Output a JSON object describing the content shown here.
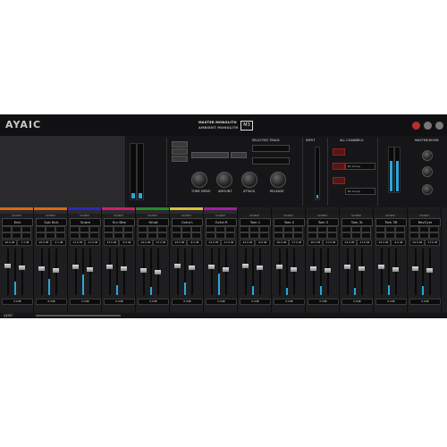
{
  "app": {
    "logo": "AYAIC",
    "brand_line1": "MASTER MONOLITH",
    "brand_line2": "AMBIENT MONOLITH",
    "badge": "M3",
    "header_buttons": [
      {
        "icon": "power-icon",
        "color": "#b23030"
      },
      {
        "icon": "settings-icon",
        "color": "#777777"
      },
      {
        "icon": "help-icon",
        "color": "#777777"
      }
    ]
  },
  "fx": {
    "selected_track_title": "SELECTED TRACK",
    "input_title": "INPUT",
    "all_channels_title": "ALL CHANNELS",
    "master_title": "MASTER/ROOM",
    "knob_labels": [
      "TONE DRIVE",
      "AMOUNT",
      "ATTACK",
      "RELEASE"
    ],
    "dropdown_value": "No Group",
    "dropdown_value_2": "No Group"
  },
  "channels": [
    {
      "name": "Kick",
      "source": "SOURCE",
      "color": "#d96a16",
      "level1": "-20.0 dB",
      "level2": "-7.4 dB",
      "gain": "0.0dB",
      "pan": 0.62,
      "meter": 0.28
    },
    {
      "name": "Sub Kick",
      "source": "SOURCE",
      "color": "#d96a16",
      "level1": "-20.0 dB",
      "level2": "-5.1 dB",
      "gain": "0.0dB",
      "pan": 0.55,
      "meter": 0.34
    },
    {
      "name": "Snare",
      "source": "SOURCE",
      "color": "#2a2ab8",
      "level1": "-17.0 dB",
      "level2": "-17.9 dB",
      "gain": "0.0dB",
      "pan": 0.58,
      "meter": 0.44
    },
    {
      "name": "Snr Btm",
      "source": "SOURCE",
      "color": "#c8236a",
      "level1": "-15.0 dB",
      "level2": "-5.8 dB",
      "gain": "0.0dB",
      "pan": 0.6,
      "meter": 0.22
    },
    {
      "name": "Hihat",
      "source": "SOURCE",
      "color": "#2a8a2a",
      "level1": "-22.0 dB",
      "level2": "-27.0 dB",
      "gain": "0.0dB",
      "pan": 0.5,
      "meter": 0.18
    },
    {
      "name": "Ovhd L",
      "source": "SOURCE",
      "color": "#d6c23a",
      "level1": "-22.0 dB",
      "level2": "-8.4 dB",
      "gain": "0.0dB",
      "pan": 0.62,
      "meter": 0.26
    },
    {
      "name": "Ovhd R",
      "source": "SOURCE",
      "color": "#a020a0",
      "level1": "-22.0 dB",
      "level2": "-17.9 dB",
      "gain": "0.0dB",
      "pan": 0.58,
      "meter": 0.46
    },
    {
      "name": "Tom 1",
      "source": "SOURCE",
      "color": "#1e1e20",
      "level1": "-22.0 dB",
      "level2": "-6.8 dB",
      "gain": "0.0dB",
      "pan": 0.62,
      "meter": 0.2
    },
    {
      "name": "Tom 2",
      "source": "SOURCE",
      "color": "#1e1e20",
      "level1": "-20.0 dB",
      "level2": "-17.9 dB",
      "gain": "0.0dB",
      "pan": 0.58,
      "meter": 0.15
    },
    {
      "name": "Tom 3",
      "source": "SOURCE",
      "color": "#1e1e20",
      "level1": "-20.0 dB",
      "level2": "-17.6 dB",
      "gain": "0.0dB",
      "pan": 0.55,
      "meter": 0.2
    },
    {
      "name": "Tom 3L",
      "source": "SOURCE",
      "color": "#1e1e20",
      "level1": "-22.0 dB",
      "level2": "-17.6 dB",
      "gain": "0.0dB",
      "pan": 0.6,
      "meter": 0.15
    },
    {
      "name": "Tom 3R",
      "source": "SOURCE",
      "color": "#1e1e20",
      "level1": "-22.0 dB",
      "level2": "-6.9 dB",
      "gain": "0.0dB",
      "pan": 0.58,
      "meter": 0.22
    },
    {
      "name": "RevCym",
      "source": "SOURCE",
      "color": "#1e1e20",
      "level1": "-22.0 dB",
      "level2": "-17.6 dB",
      "gain": "0.0dB",
      "pan": 0.55,
      "meter": 0.2
    }
  ],
  "footer": {
    "signature": "ayaic"
  }
}
